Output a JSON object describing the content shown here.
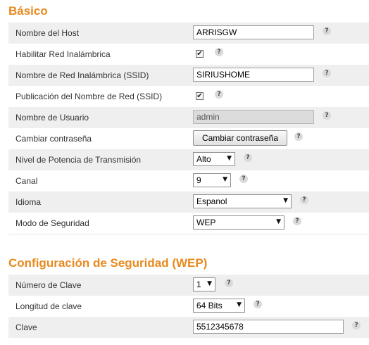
{
  "basic": {
    "title": "Básico",
    "rows": [
      {
        "label": "Nombre del Host",
        "value": "ARRISGW"
      },
      {
        "label": "Habilitar Red Inalámbrica",
        "checked": true
      },
      {
        "label": "Nombre de Red Inalámbrica (SSID)",
        "value": "SIRIUSHOME"
      },
      {
        "label": "Publicación del Nombre de Red (SSID)",
        "checked": true
      },
      {
        "label": "Nombre de Usuario",
        "value": "admin",
        "disabled": true
      },
      {
        "label": "Cambiar contraseña",
        "button": "Cambiar contraseña"
      },
      {
        "label": "Nivel de Potencia de Transmisión",
        "selected": "Alto"
      },
      {
        "label": "Canal",
        "selected": "9"
      },
      {
        "label": "Idioma",
        "selected": "Espanol"
      },
      {
        "label": "Modo de Seguridad",
        "selected": "WEP"
      }
    ]
  },
  "security": {
    "title": "Configuración de Seguridad (WEP)",
    "rows": [
      {
        "label": "Número de Clave",
        "selected": "1"
      },
      {
        "label": "Longitud de clave",
        "selected": "64 Bits"
      },
      {
        "label": "Clave",
        "value": "5512345678"
      }
    ]
  },
  "help_glyph": "?",
  "check_glyph": "✔",
  "icons": {
    "help": "question-mark-icon",
    "dropdown": "chevron-down-icon",
    "check": "checkmark-icon"
  },
  "colors": {
    "title": "#e8891e",
    "row_shade": "#efefef"
  }
}
